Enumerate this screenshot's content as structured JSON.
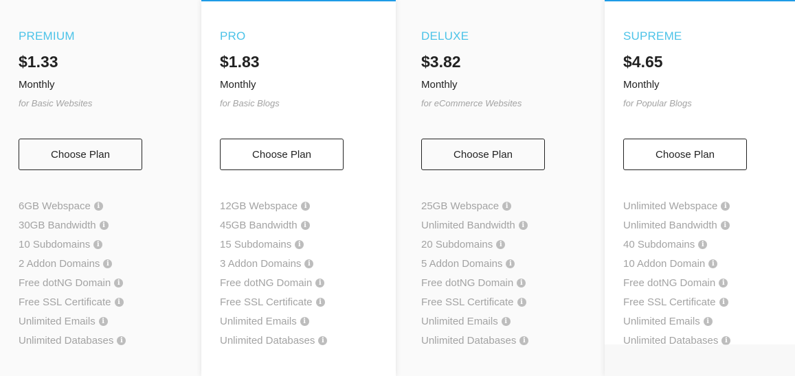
{
  "plans": [
    {
      "name": "PREMIUM",
      "price": "$1.33",
      "period": "Monthly",
      "tagline": "for Basic Websites",
      "cta": "Choose Plan",
      "features": [
        "6GB Webspace",
        "30GB Bandwidth",
        "10 Subdomains",
        "2 Addon Domains",
        "Free dotNG Domain",
        "Free SSL Certificate",
        "Unlimited Emails",
        "Unlimited Databases"
      ]
    },
    {
      "name": "PRO",
      "price": "$1.83",
      "period": "Monthly",
      "tagline": "for Basic Blogs",
      "cta": "Choose Plan",
      "features": [
        "12GB Webspace",
        "45GB Bandwidth",
        "15 Subdomains",
        "3 Addon Domains",
        "Free dotNG Domain",
        "Free SSL Certificate",
        "Unlimited Emails",
        "Unlimited Databases"
      ]
    },
    {
      "name": "DELUXE",
      "price": "$3.82",
      "period": "Monthly",
      "tagline": "for eCommerce Websites",
      "cta": "Choose Plan",
      "features": [
        "25GB Webspace",
        "Unlimited Bandwidth",
        "20 Subdomains",
        "5 Addon Domains",
        "Free dotNG Domain",
        "Free SSL Certificate",
        "Unlimited Emails",
        "Unlimited Databases"
      ]
    },
    {
      "name": "SUPREME",
      "price": "$4.65",
      "period": "Monthly",
      "tagline": "for Popular Blogs",
      "cta": "Choose Plan",
      "features": [
        "Unlimited Webspace",
        "Unlimited Bandwidth",
        "40 Subdomains",
        "10 Addon Domain",
        "Free dotNG Domain",
        "Free SSL Certificate",
        "Unlimited Emails",
        "Unlimited Databases"
      ]
    }
  ],
  "icons": {
    "feature_info": "info-circle-icon"
  },
  "colors": {
    "plan_name": "#4cc3e8",
    "featured_border": "#1e9be6",
    "price_text": "#222222",
    "feature_text": "#a3a3a3",
    "info_icon": "#bdbdbd"
  }
}
